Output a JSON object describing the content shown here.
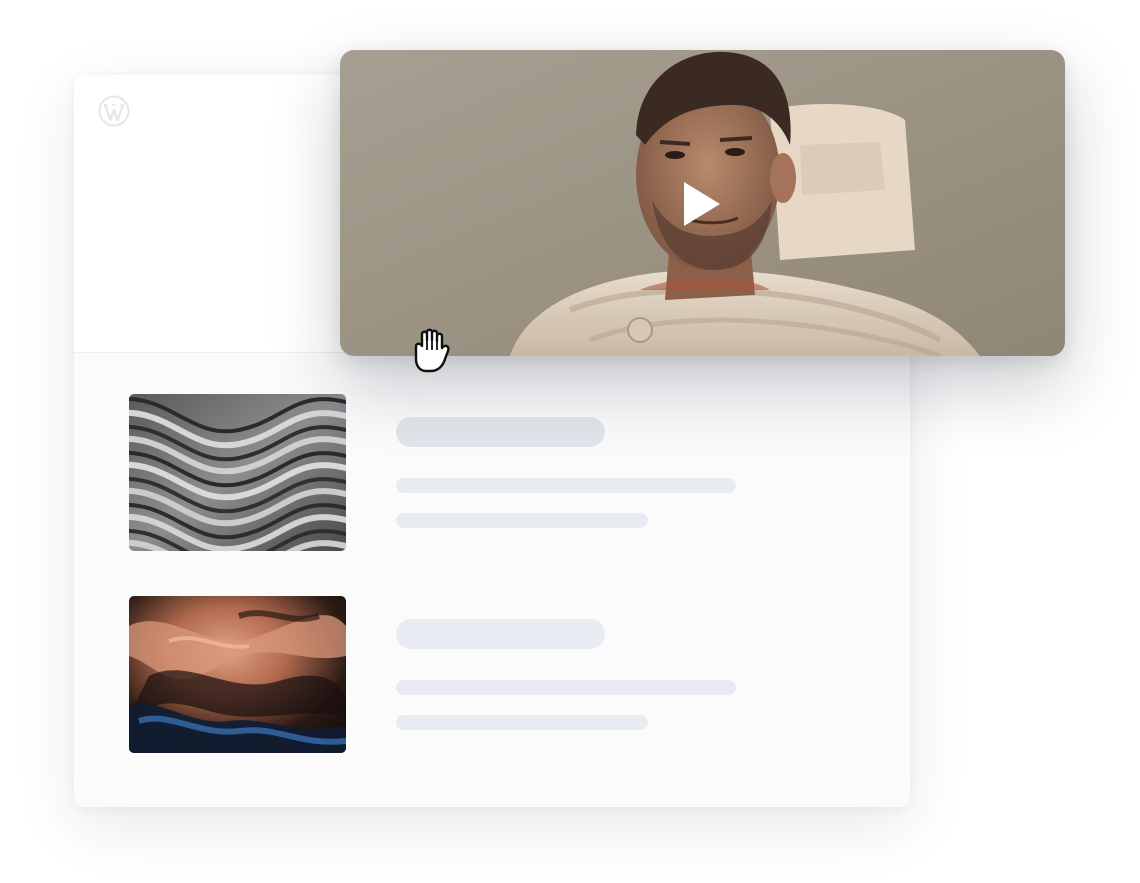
{
  "page": {
    "background": "#ffffff",
    "card_background": "#fbfbfc",
    "skeleton_color": "#e7ebf1"
  },
  "header": {
    "logo_icon": "wordpress-logo-icon"
  },
  "video": {
    "description_icon": "play-icon",
    "play_color": "#ffffff"
  },
  "posts": [
    {
      "thumbnail": "wavy-concrete-texture",
      "title_placeholder": "",
      "excerpt_placeholder": ""
    },
    {
      "thumbnail": "orange-blue-fluid-paint",
      "title_placeholder": "",
      "excerpt_placeholder": ""
    }
  ],
  "pointer": {
    "icon": "hand-cursor-icon"
  }
}
